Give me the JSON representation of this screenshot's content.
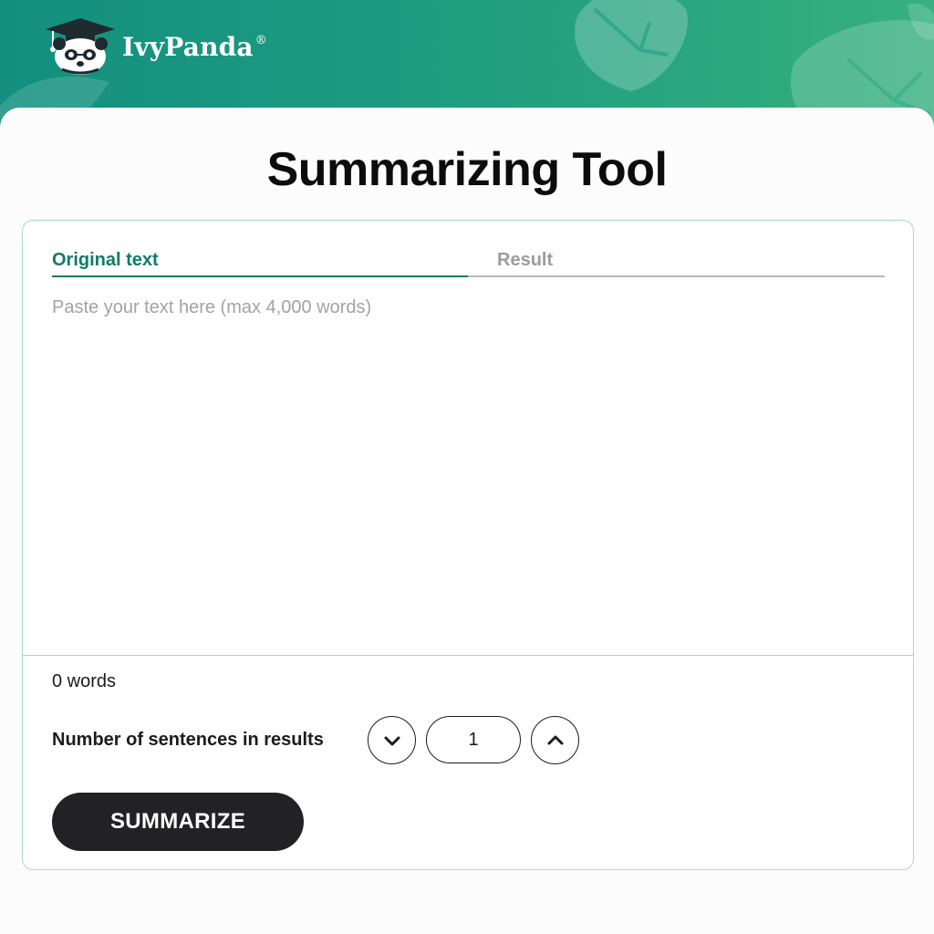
{
  "brand": {
    "name": "IvyPanda",
    "registered_mark": "®",
    "logo_icon": "panda-graduate-icon",
    "header_gradient_start": "#138f7f",
    "header_gradient_end": "#38b081",
    "leaf_icon": "ivy-leaf-icon"
  },
  "page": {
    "title": "Summarizing Tool"
  },
  "tabs": [
    {
      "label": "Original text",
      "active": true,
      "color": "#137a68"
    },
    {
      "label": "Result",
      "active": false,
      "color": "#9c9c9c"
    }
  ],
  "editor": {
    "placeholder": "Paste your text here (max 4,000 words)",
    "value": ""
  },
  "stats": {
    "word_count": "0 words"
  },
  "sentences": {
    "label": "Number of sentences in results",
    "value": "1",
    "decrease_icon": "chevron-down-icon",
    "increase_icon": "chevron-up-icon"
  },
  "actions": {
    "summarize_label": "SUMMARIZE",
    "summarize_color": "#222224"
  }
}
